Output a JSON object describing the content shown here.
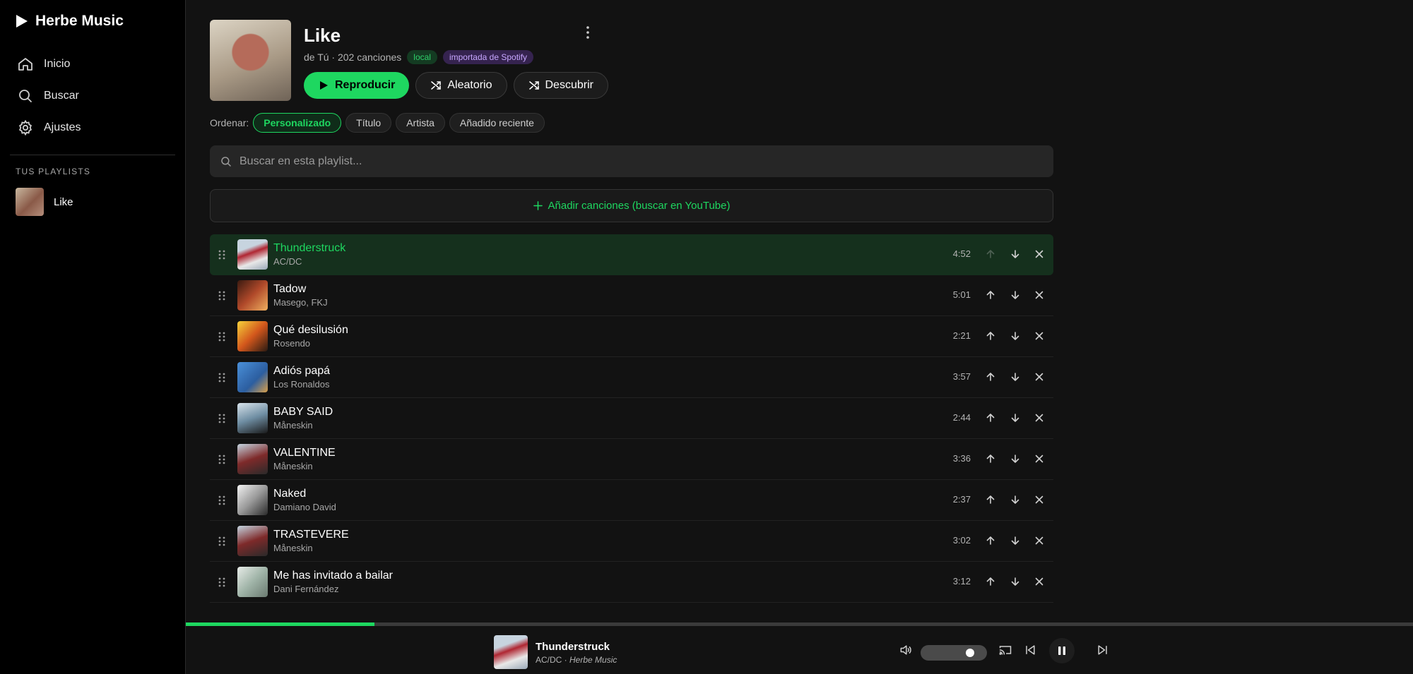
{
  "app": {
    "name": "Herbe Music"
  },
  "nav": [
    {
      "label": "Inicio",
      "icon": "home-icon"
    },
    {
      "label": "Buscar",
      "icon": "search-icon"
    },
    {
      "label": "Ajustes",
      "icon": "gear-icon"
    }
  ],
  "sidebar": {
    "playlists_heading": "TUS PLAYLISTS",
    "playlists": [
      {
        "name": "Like"
      }
    ]
  },
  "playlist": {
    "title": "Like",
    "meta": "de Tú · 202 canciones",
    "tags": [
      "local",
      "importada de Spotify"
    ],
    "actions": {
      "play": "Reproducir",
      "shuffle": "Aleatorio",
      "discover": "Descubrir"
    },
    "sort_label": "Ordenar:",
    "sort_options": [
      "Personalizado",
      "Título",
      "Artista",
      "Añadido reciente"
    ],
    "sort_selected": "Personalizado",
    "search_placeholder": "Buscar en esta playlist...",
    "add_songs": "Añadir canciones (buscar en YouTube)"
  },
  "tracks": [
    {
      "title": "Thunderstruck",
      "artist": "AC/DC",
      "duration": "4:52",
      "active": true
    },
    {
      "title": "Tadow",
      "artist": "Masego, FKJ",
      "duration": "5:01"
    },
    {
      "title": "Qué desilusión",
      "artist": "Rosendo",
      "duration": "2:21"
    },
    {
      "title": "Adiós papá",
      "artist": "Los Ronaldos",
      "duration": "3:57"
    },
    {
      "title": "BABY SAID",
      "artist": "Måneskin",
      "duration": "2:44"
    },
    {
      "title": "VALENTINE",
      "artist": "Måneskin",
      "duration": "3:36"
    },
    {
      "title": "Naked",
      "artist": "Damiano David",
      "duration": "2:37"
    },
    {
      "title": "TRASTEVERE",
      "artist": "Måneskin",
      "duration": "3:02"
    },
    {
      "title": "Me has invitado a bailar",
      "artist": "Dani Fernández",
      "duration": "3:12"
    }
  ],
  "player": {
    "title": "Thunderstruck",
    "artist": "AC/DC",
    "source": "Herbe Music",
    "progress": 0.154,
    "volume": 0.82
  },
  "colors": {
    "accent": "#1ed760",
    "background": "#121212",
    "sidebar": "#000000"
  }
}
